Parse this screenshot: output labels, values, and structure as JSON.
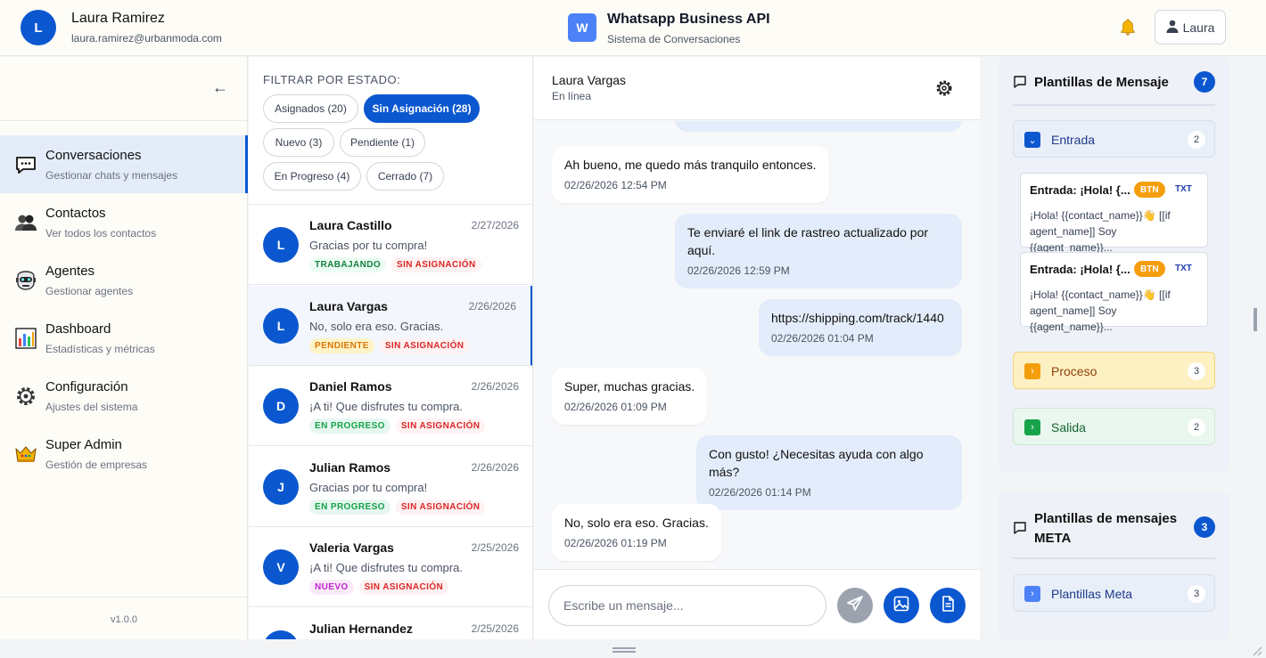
{
  "header": {
    "user_initial": "L",
    "user_name": "Laura Ramirez",
    "user_email": "laura.ramirez@urbanmoda.com",
    "brand_initial": "W",
    "brand_title": "Whatsapp Business API",
    "brand_subtitle": "Sistema de Conversaciones",
    "profile_label": "Laura"
  },
  "sidebar": {
    "back_icon": "←",
    "items": [
      {
        "label": "Conversaciones",
        "sub": "Gestionar chats y mensajes",
        "icon": "chat-bubble-icon"
      },
      {
        "label": "Contactos",
        "sub": "Ver todos los contactos",
        "icon": "people-icon"
      },
      {
        "label": "Agentes",
        "sub": "Gestionar agentes",
        "icon": "robot-icon"
      },
      {
        "label": "Dashboard",
        "sub": "Estadísticas y métricas",
        "icon": "bar-chart-icon"
      },
      {
        "label": "Configuración",
        "sub": "Ajustes del sistema",
        "icon": "gear-icon"
      },
      {
        "label": "Super Admin",
        "sub": "Gestión de empresas",
        "icon": "crown-icon"
      }
    ],
    "version": "v1.0.0"
  },
  "filters": {
    "title": "FILTRAR POR ESTADO:",
    "chips": [
      "Asignados (20)",
      "Sin Asignación (28)",
      "Nuevo (3)",
      "Pendiente (1)",
      "En Progreso (4)",
      "Cerrado (7)"
    ]
  },
  "conversations": [
    {
      "initial": "L",
      "name": "Laura Castillo",
      "date": "2/27/2026",
      "message": "Gracias por tu compra!",
      "status": "TRABAJANDO",
      "assign": "SIN ASIGNACIÓN"
    },
    {
      "initial": "L",
      "name": "Laura Vargas",
      "date": "2/26/2026",
      "message": "No, solo era eso. Gracias.",
      "status": "PENDIENTE",
      "assign": "SIN ASIGNACIÓN"
    },
    {
      "initial": "D",
      "name": "Daniel Ramos",
      "date": "2/26/2026",
      "message": "¡A ti! Que disfrutes tu compra.",
      "status": "EN PROGRESO",
      "assign": "SIN ASIGNACIÓN"
    },
    {
      "initial": "J",
      "name": "Julian Ramos",
      "date": "2/26/2026",
      "message": "Gracias por tu compra!",
      "status": "EN PROGRESO",
      "assign": "SIN ASIGNACIÓN"
    },
    {
      "initial": "V",
      "name": "Valeria Vargas",
      "date": "2/25/2026",
      "message": "¡A ti! Que disfrutes tu compra.",
      "status": "NUEVO",
      "assign": "SIN ASIGNACIÓN"
    },
    {
      "initial": "J",
      "name": "Julian Hernandez",
      "date": "2/25/2026",
      "message": "",
      "status": "",
      "assign": ""
    }
  ],
  "chat": {
    "contact_name": "Laura Vargas",
    "contact_status": "En línea",
    "messages": [
      {
        "text": "Ah bueno, me quedo más tranquilo entonces.",
        "time": "02/26/2026 12:54 PM"
      },
      {
        "text": "Te enviaré el link de rastreo actualizado por aquí.",
        "time": "02/26/2026 12:59 PM"
      },
      {
        "text": "https://shipping.com/track/1440",
        "time": "02/26/2026 01:04 PM"
      },
      {
        "text": "Super, muchas gracias.",
        "time": "02/26/2026 01:09 PM"
      },
      {
        "text": "Con gusto! ¿Necesitas ayuda con algo más?",
        "time": "02/26/2026 01:14 PM"
      },
      {
        "text": "No, solo era eso. Gracias.",
        "time": "02/26/2026 01:19 PM"
      }
    ],
    "input_placeholder": "Escribe un mensaje..."
  },
  "templates": {
    "title": "Plantillas de Mensaje",
    "count": "7",
    "sections": [
      {
        "label": "Entrada",
        "count": "2",
        "arrow": "⌄"
      },
      {
        "label": "Proceso",
        "count": "3",
        "arrow": "›"
      },
      {
        "label": "Salida",
        "count": "2",
        "arrow": "›"
      }
    ],
    "items": [
      {
        "title": "Entrada: ¡Hola! {...",
        "badge1": "BTN",
        "badge2": "TXT",
        "body": "¡Hola! {{contact_name}}👋 [[if agent_name]] Soy {{agent_name}}..."
      },
      {
        "title": "Entrada: ¡Hola! {...",
        "badge1": "BTN",
        "badge2": "TXT",
        "body": "¡Hola! {{contact_name}}👋 [[if agent_name]] Soy {{agent_name}}..."
      }
    ]
  },
  "meta": {
    "title": "Plantillas de mensajes META",
    "count": "3",
    "section_label": "Plantillas Meta",
    "section_count": "3",
    "arrow": "›"
  },
  "colors": {
    "accent": "#0b57d0",
    "brand": "#4c82f7",
    "warning": "#f59e0b",
    "success": "#16a34a",
    "danger": "#dc2626"
  }
}
